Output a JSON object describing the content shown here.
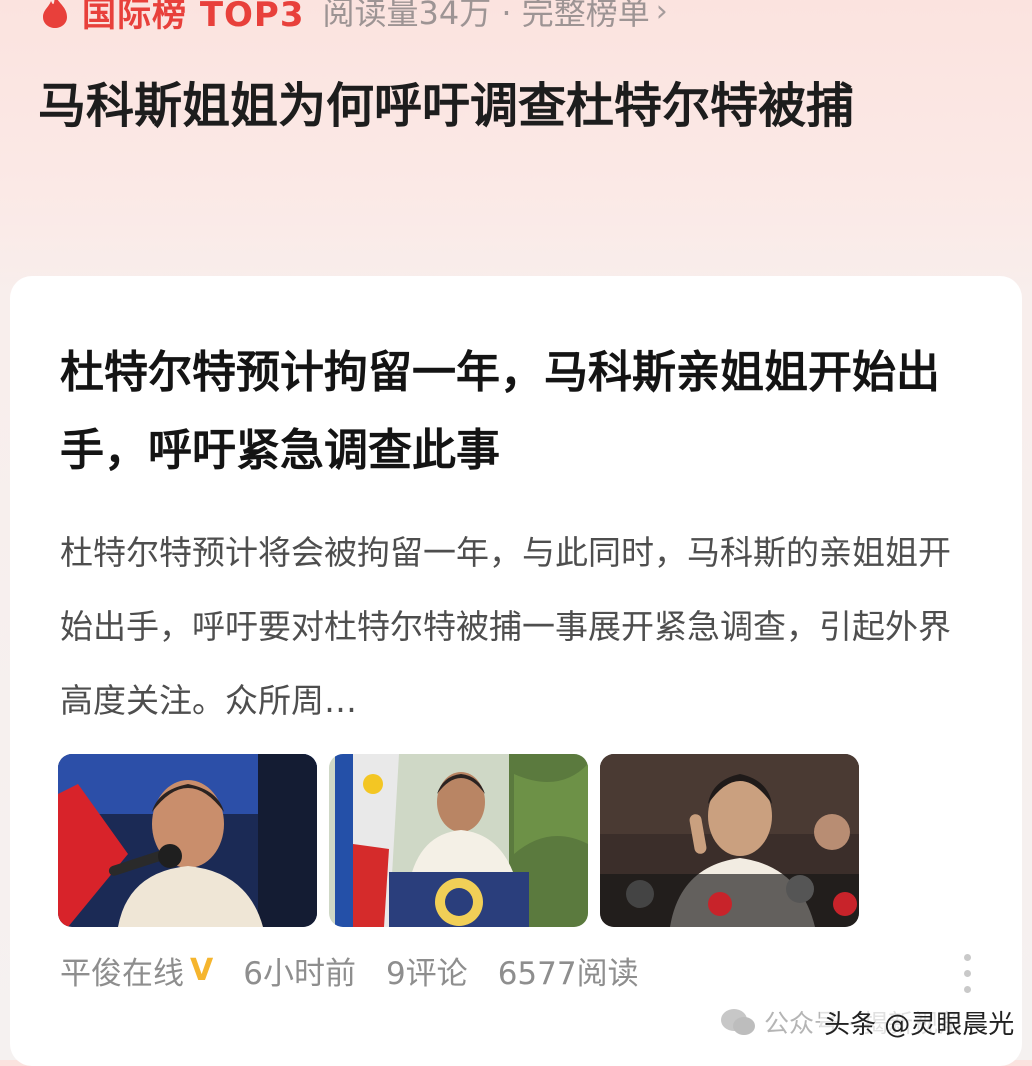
{
  "header": {
    "rank_label": "国际榜 TOP3",
    "read_info": "阅读量34万 · 完整榜单",
    "chevron": "›"
  },
  "headline": "马科斯姐姐为何呼吁调查杜特尔特被捕",
  "card": {
    "title": "杜特尔特预计拘留一年，马科斯亲姐姐开始出手，呼吁紧急调查此事",
    "summary": "杜特尔特预计将会被拘留一年，与此同时，马科斯的亲姐姐开始出手，呼吁要对杜特尔特被捕一事展开紧急调查，引起外界高度关注。众所周…",
    "meta": {
      "author": "平俊在线",
      "verified_badge": "V",
      "time": "6小时前",
      "comments": "9评论",
      "reads": "6577阅读"
    }
  },
  "watermark": {
    "text": "公众号 · 揭新视角",
    "source": "头条 @灵眼晨光"
  },
  "colors": {
    "accent": "#e8403b",
    "badge": "#f5b52e"
  },
  "icons": [
    "fire-icon",
    "chevron-right-icon",
    "verified-icon",
    "more-icon",
    "wechat-icon"
  ]
}
